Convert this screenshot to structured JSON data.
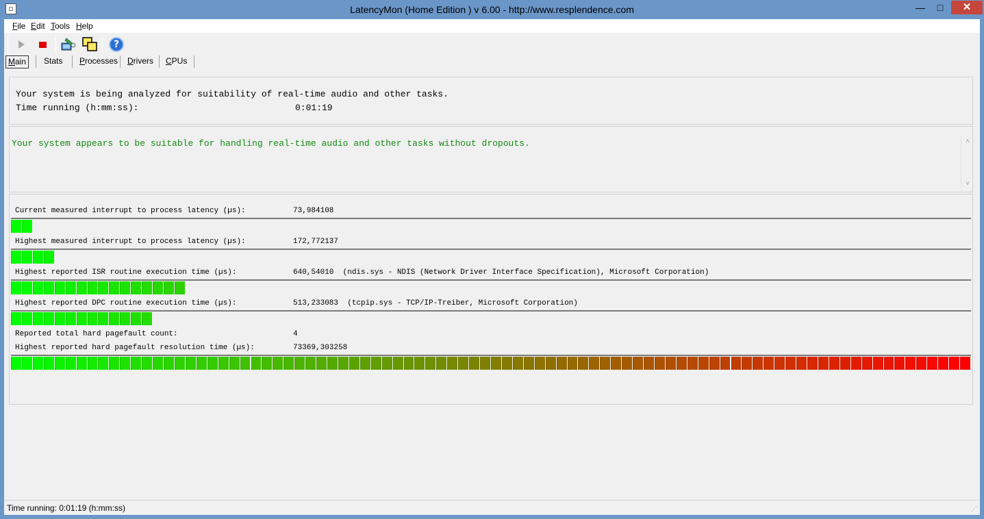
{
  "window": {
    "title": "LatencyMon  (Home Edition )  v 6.00 - http://www.resplendence.com",
    "app_icon": "document-icon",
    "minimize_glyph": "—",
    "maximize_glyph": "□",
    "close_glyph": "✕"
  },
  "menu": {
    "file": {
      "key": "F",
      "rest": "ile"
    },
    "edit": {
      "key": "E",
      "rest": "dit"
    },
    "tools": {
      "key": "T",
      "rest": "ools"
    },
    "help": {
      "key": "H",
      "rest": "elp"
    }
  },
  "toolbar": {
    "start": "play-icon",
    "stop": "stop-icon",
    "analyze": "wrench-pc-icon",
    "windows": "overlap-windows-icon",
    "help": "help-icon",
    "help_glyph": "?"
  },
  "tabs": [
    {
      "key": "M",
      "rest": "ain",
      "active": true
    },
    {
      "key": "S",
      "rest": "tats",
      "active": false
    },
    {
      "key": "P",
      "rest": "rocesses",
      "active": false
    },
    {
      "key": "D",
      "rest": "rivers",
      "active": false
    },
    {
      "key": "C",
      "rest": "PUs",
      "active": false
    }
  ],
  "summary": {
    "status_line": "Your system is being analyzed for suitability of real-time audio and other tasks.",
    "time_label": "Time running (h:mm:ss):",
    "time_value": "0:01:19"
  },
  "verdict": {
    "text": "Your system appears to be suitable for handling real-time audio and other tasks without dropouts.",
    "color": "#128a12",
    "scroll_up": "˄",
    "scroll_down": "˅"
  },
  "metrics": {
    "current_latency": {
      "label": "Current measured interrupt to process latency (µs):",
      "value": "73,984108",
      "detail": "",
      "level": 0.021
    },
    "highest_latency": {
      "label": "Highest measured interrupt to process latency (µs):",
      "value": "172,772137",
      "detail": "",
      "level": 0.044
    },
    "highest_isr": {
      "label": "Highest reported ISR routine execution time (µs):",
      "value": "640,54010",
      "detail": "(ndis.sys - NDIS (Network Driver Interface Specification), Microsoft Corporation)",
      "level": 0.182
    },
    "highest_dpc": {
      "label": "Highest reported DPC routine execution time (µs):",
      "value": "513,233083",
      "detail": "(tcpip.sys - TCP/IP-Treiber, Microsoft Corporation)",
      "level": 0.148
    },
    "pagefault_count": {
      "label": "Reported total hard pagefault count:",
      "value": "4"
    },
    "pagefault_time": {
      "label": "Highest reported hard pagefault resolution time (µs):",
      "value": "73369,303258",
      "detail": "",
      "level": 1.0
    }
  },
  "status_bar": {
    "text": "Time running: 0:01:19  (h:mm:ss)",
    "grip": "⋰"
  },
  "colors": {
    "bar_green": "#00ff00",
    "bar_red": "#ff0000",
    "title_bar": "#6b96c8",
    "close_button": "#c7463c"
  }
}
